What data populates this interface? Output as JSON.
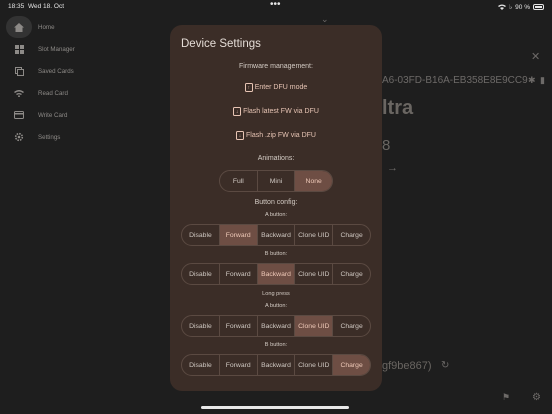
{
  "status": {
    "time": "18:35",
    "date": "Wed 18. Oct",
    "dots": "•••",
    "battery": "90 %"
  },
  "sidebar": {
    "items": [
      {
        "label": "Home",
        "icon": "home-icon",
        "active": true
      },
      {
        "label": "Slot Manager",
        "icon": "grid-icon"
      },
      {
        "label": "Saved Cards",
        "icon": "copy-icon"
      },
      {
        "label": "Read Card",
        "icon": "wifi-icon"
      },
      {
        "label": "Write Card",
        "icon": "card-icon"
      },
      {
        "label": "Settings",
        "icon": "gear-icon"
      }
    ]
  },
  "background": {
    "device_id": "A6-03FD-B16A-EB358E8E9CC9",
    "model_partial": "ltra",
    "number_partial": "8",
    "hash_partial": "gf9be867)"
  },
  "dialog": {
    "title": "Device Settings",
    "firmware": {
      "heading": "Firmware management:",
      "enter_dfu": "Enter DFU mode",
      "flash_latest": "Flash latest FW via DFU",
      "flash_zip": "Flash .zip FW via DFU"
    },
    "animations": {
      "heading": "Animations:",
      "options": [
        "Full",
        "Mini",
        "None"
      ],
      "selected": "None"
    },
    "button_config": {
      "heading": "Button config:",
      "a_label": "A button:",
      "b_label": "B button:",
      "long_press": "Long press",
      "long_a_label": "A button:",
      "long_b_label": "B button:",
      "options": [
        "Disable",
        "Forward",
        "Backward",
        "Clone UID",
        "Charge"
      ],
      "a_selected": "Forward",
      "b_selected": "Backward",
      "long_a_selected": "Clone UID",
      "long_b_selected": "Charge"
    }
  },
  "colors": {
    "dialog_bg": "#3b2d27",
    "accent": "#e7c4b4",
    "selected_bg": "#6e4e44"
  }
}
